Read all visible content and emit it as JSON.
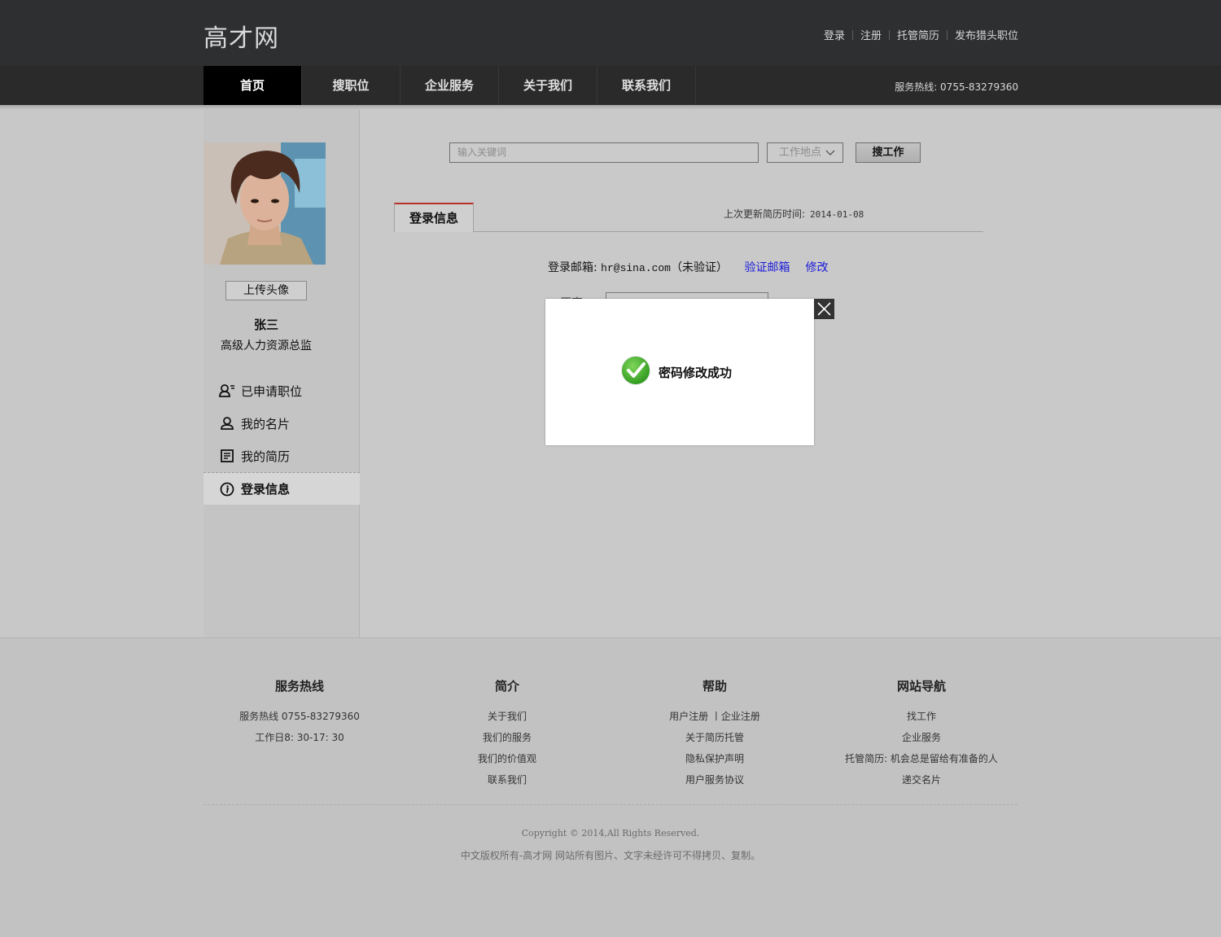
{
  "header": {
    "logo": "高才网",
    "links": [
      "登录",
      "注册",
      "托管简历",
      "发布猎头职位"
    ],
    "nav": [
      "首页",
      "搜职位",
      "企业服务",
      "关于我们",
      "联系我们"
    ],
    "active_nav": "首页",
    "hotline": "服务热线: 0755-83279360"
  },
  "sidebar": {
    "upload_label": "上传头像",
    "name": "张三",
    "title": "高级人力资源总监",
    "menu": [
      {
        "label": "已申请职位",
        "icon": "applied-jobs-icon"
      },
      {
        "label": "我的名片",
        "icon": "user-card-icon"
      },
      {
        "label": "我的简历",
        "icon": "resume-icon"
      },
      {
        "label": "登录信息",
        "icon": "info-icon",
        "active": true
      }
    ]
  },
  "search": {
    "placeholder": "输入关键词",
    "location": "工作地点",
    "button": "搜工作"
  },
  "tab": {
    "label": "登录信息",
    "updated_label": "上次更新简历时间:",
    "updated_date": "2014-01-08"
  },
  "login_info": {
    "email_label": "登录邮箱:",
    "email": "hr@sina.com",
    "status": "（未验证）",
    "verify_link": "验证邮箱",
    "edit_link": "修改",
    "partial_label": "原密码:"
  },
  "modal": {
    "message": "密码修改成功"
  },
  "footer": {
    "columns": [
      {
        "title": "服务热线",
        "lines": [
          "服务热线 0755-83279360",
          "工作日8: 30-17: 30"
        ]
      },
      {
        "title": "简介",
        "lines": [
          "关于我们",
          "我们的服务",
          "我们的价值观",
          "联系我们"
        ]
      },
      {
        "title": "帮助",
        "lines": [
          "用户注册 丨企业注册",
          "关于简历托管",
          "隐私保护声明",
          "用户服务协议"
        ]
      },
      {
        "title": "网站导航",
        "lines": [
          "找工作",
          "企业服务",
          "托管简历: 机会总是留给有准备的人",
          "递交名片"
        ]
      }
    ],
    "copyright": "Copyright © 2014,All Rights Reserved.",
    "notice": "中文版权所有-高才网 网站所有图片、文字未经许可不得拷贝、复制。"
  },
  "colors": {
    "header_bg": "#2d2f31",
    "nav_active": "#000000",
    "tab_accent": "#b8322a",
    "link": "#1a1adb",
    "success_green": "#3fae2a"
  }
}
